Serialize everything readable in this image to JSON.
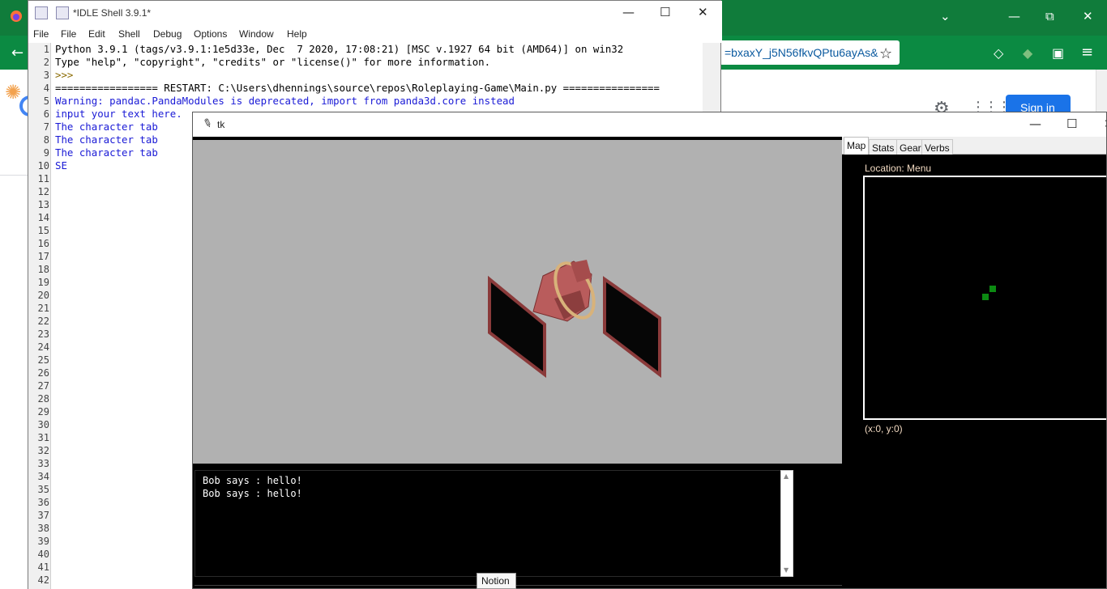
{
  "browser": {
    "url_fragment": "=bxaxY_j5N56fkvQPtu6ayAs&",
    "google_signin_label": "Sign in",
    "minimize_glyph": "—",
    "restore_glyph": "⧉",
    "close_glyph": "✕",
    "chevron_glyph": "⌄",
    "star_glyph": "☆",
    "back_glyph": "←",
    "pocket_glyph": "◇",
    "menu_glyph": "≡",
    "gear_glyph": "⚙",
    "apps_glyph": "⋮⋮⋮",
    "spinner_glyph": "✺"
  },
  "idle": {
    "title": "*IDLE Shell 3.9.1*",
    "menu": [
      "File",
      "Edit",
      "Shell",
      "Debug",
      "Options",
      "Window",
      "Help"
    ],
    "window_buttons": {
      "minimize": "—",
      "maximize": "☐",
      "close": "✕"
    },
    "line_numbers": [
      "1",
      "2",
      "3",
      "4",
      "5",
      "6",
      "7",
      "8",
      "9",
      "10",
      "11",
      "12",
      "13",
      "14",
      "15",
      "16",
      "17",
      "18",
      "19",
      "20",
      "21",
      "22",
      "23",
      "24",
      "25",
      "26",
      "27",
      "28",
      "29",
      "30",
      "31",
      "32",
      "33",
      "34",
      "35",
      "36",
      "37",
      "38",
      "39",
      "40",
      "41",
      "42"
    ],
    "lines": [
      {
        "text": "Python 3.9.1 (tags/v3.9.1:1e5d33e, Dec  7 2020, 17:08:21) [MSC v.1927 64 bit (AMD64)] on win32",
        "color": "black"
      },
      {
        "text": "Type \"help\", \"copyright\", \"credits\" or \"license()\" for more information.",
        "color": "black"
      },
      {
        "text": ">>> ",
        "color": "prompt"
      },
      {
        "text": "================= RESTART: C:\\Users\\dhennings\\source\\repos\\Roleplaying-Game\\Main.py ================",
        "color": "black"
      },
      {
        "text": "Warning: pandac.PandaModules is deprecated, import from panda3d.core instead",
        "color": "blue"
      },
      {
        "text": "input your text here.",
        "color": "blue"
      },
      {
        "text": "The character tab",
        "color": "blue"
      },
      {
        "text": "The character tab",
        "color": "blue"
      },
      {
        "text": "The character tab",
        "color": "blue"
      },
      {
        "text": "SE",
        "color": "blue"
      }
    ]
  },
  "tk": {
    "title": "tk",
    "window_buttons": {
      "minimize": "—",
      "maximize": "☐",
      "close": "✕"
    },
    "tabs": [
      "Map",
      "Stats",
      "Gear",
      "Verbs"
    ],
    "active_tab": "Map",
    "location_label": "Location: Menu",
    "coords_label": "(x:0, y:0)",
    "chat_lines": [
      "Bob says : hello!",
      "Bob says : hello!"
    ],
    "map_tile_color": "#0c8a12"
  },
  "taskbar_tooltip": "Notion"
}
